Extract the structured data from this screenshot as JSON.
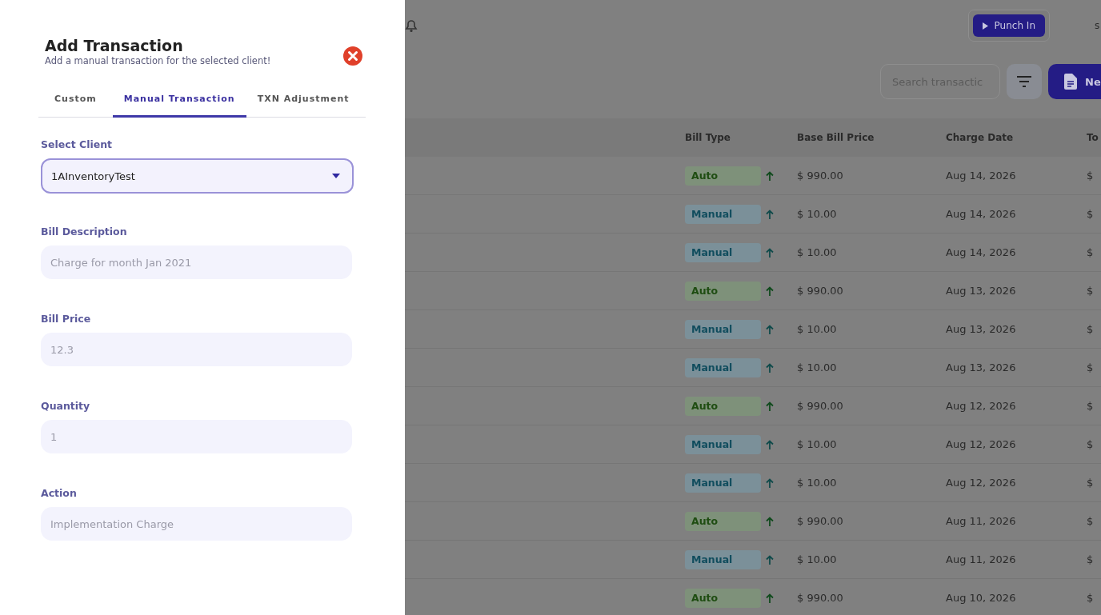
{
  "drawer": {
    "title": "Add Transaction",
    "subtitle": "Add a manual transaction for the selected client!",
    "tabs": [
      {
        "label": "Custom",
        "selected": false
      },
      {
        "label": "Manual Transaction",
        "selected": true
      },
      {
        "label": "TXN Adjustment",
        "selected": false
      }
    ],
    "fields": [
      {
        "kind": "select",
        "label": "Select Client",
        "value": "1AInventoryTest"
      },
      {
        "kind": "text",
        "label": "Bill Description",
        "placeholder": "Charge for month Jan 2021"
      },
      {
        "kind": "text",
        "label": "Bill Price",
        "placeholder": "12.3"
      },
      {
        "kind": "text",
        "label": "Quantity",
        "placeholder": "1"
      },
      {
        "kind": "text",
        "label": "Action",
        "placeholder": "Implementation Charge"
      }
    ]
  },
  "topbar": {
    "punch_button": "Punch In",
    "user_text": "s"
  },
  "toolbar": {
    "search": {
      "placeholder": "Search transactic"
    },
    "new_button": "Ne"
  },
  "table": {
    "columns": [
      "Bill Type",
      "Base Bill Price",
      "Charge Date",
      "To"
    ],
    "rows": [
      {
        "bill_type": "Auto",
        "kind": "auto",
        "base_price": "$ 990.00",
        "charge_date": "Aug 14, 2026",
        "column_5": "$"
      },
      {
        "bill_type": "Manual",
        "kind": "manual",
        "base_price": "$ 10.00",
        "charge_date": "Aug 14, 2026",
        "column_5": "$"
      },
      {
        "bill_type": "Manual",
        "kind": "manual",
        "base_price": "$ 10.00",
        "charge_date": "Aug 14, 2026",
        "column_5": "$"
      },
      {
        "bill_type": "Auto",
        "kind": "auto",
        "base_price": "$ 990.00",
        "charge_date": "Aug 13, 2026",
        "column_5": "$"
      },
      {
        "bill_type": "Manual",
        "kind": "manual",
        "base_price": "$ 10.00",
        "charge_date": "Aug 13, 2026",
        "column_5": "$"
      },
      {
        "bill_type": "Manual",
        "kind": "manual",
        "base_price": "$ 10.00",
        "charge_date": "Aug 13, 2026",
        "column_5": "$"
      },
      {
        "bill_type": "Auto",
        "kind": "auto",
        "base_price": "$ 990.00",
        "charge_date": "Aug 12, 2026",
        "column_5": "$"
      },
      {
        "bill_type": "Manual",
        "kind": "manual",
        "base_price": "$ 10.00",
        "charge_date": "Aug 12, 2026",
        "column_5": "$"
      },
      {
        "bill_type": "Manual",
        "kind": "manual",
        "base_price": "$ 10.00",
        "charge_date": "Aug 12, 2026",
        "column_5": "$"
      },
      {
        "bill_type": "Auto",
        "kind": "auto",
        "base_price": "$ 990.00",
        "charge_date": "Aug 11, 2026",
        "column_5": "$"
      },
      {
        "bill_type": "Manual",
        "kind": "manual",
        "base_price": "$ 10.00",
        "charge_date": "Aug 11, 2026",
        "column_5": "$"
      },
      {
        "bill_type": "Auto",
        "kind": "auto",
        "base_price": "$ 990.00",
        "charge_date": "Aug 10, 2026",
        "column_5": "$"
      }
    ]
  }
}
